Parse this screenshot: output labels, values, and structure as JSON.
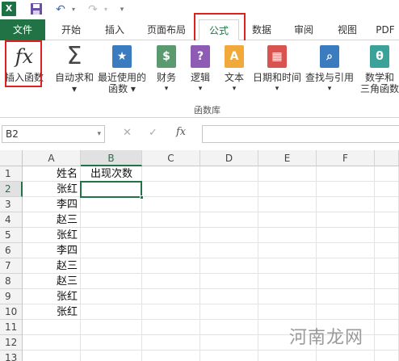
{
  "app": {
    "logo_letter": "X"
  },
  "tabs": [
    {
      "label": "文件"
    },
    {
      "label": "开始"
    },
    {
      "label": "插入"
    },
    {
      "label": "页面布局"
    },
    {
      "label": "公式"
    },
    {
      "label": "数据"
    },
    {
      "label": "审阅"
    },
    {
      "label": "视图"
    },
    {
      "label": "PDF"
    }
  ],
  "ribbon": {
    "insert_function": {
      "glyph": "fx",
      "label": "插入函数"
    },
    "autosum": {
      "glyph": "Σ",
      "label": "自动求和"
    },
    "recent": {
      "glyph": "★",
      "label_line1": "最近使用的",
      "label_line2": "函数"
    },
    "financial": {
      "glyph": "$",
      "label": "财务"
    },
    "logical": {
      "glyph": "?",
      "label": "逻辑"
    },
    "text": {
      "glyph": "A",
      "label": "文本"
    },
    "datetime": {
      "glyph": "▦",
      "label": "日期和时间"
    },
    "lookup": {
      "glyph": "⌕",
      "label": "查找与引用"
    },
    "math": {
      "glyph": "θ",
      "label_line1": "数学和",
      "label_line2": "三角函数"
    },
    "group_label": "函数库",
    "colors": {
      "financial": "#5b9a6f",
      "logical": "#8e5bb5",
      "text": "#f2a93b",
      "datetime": "#d9534f",
      "lookup": "#3b7bbf",
      "math": "#3ba29a",
      "recent": "#3b7bbf"
    }
  },
  "formula_bar": {
    "name_box": "B2",
    "cancel_glyph": "✕",
    "enter_glyph": "✓",
    "fx_glyph": "fx",
    "formula": ""
  },
  "grid": {
    "columns": [
      "A",
      "B",
      "C",
      "D",
      "E",
      "F"
    ],
    "rows": [
      "1",
      "2",
      "3",
      "4",
      "5",
      "6",
      "7",
      "8",
      "9",
      "10",
      "11",
      "12",
      "13"
    ],
    "cells": {
      "A1": "姓名",
      "B1": "出现次数",
      "A2": "张红",
      "A3": "李四",
      "A4": "赵三",
      "A5": "张红",
      "A6": "李四",
      "A7": "赵三",
      "A8": "赵三",
      "A9": "张红",
      "A10": "张红"
    },
    "selected_cell": "B2"
  },
  "watermark": "河南龙网",
  "accent_color": "#217346",
  "highlight_color": "#e02020"
}
